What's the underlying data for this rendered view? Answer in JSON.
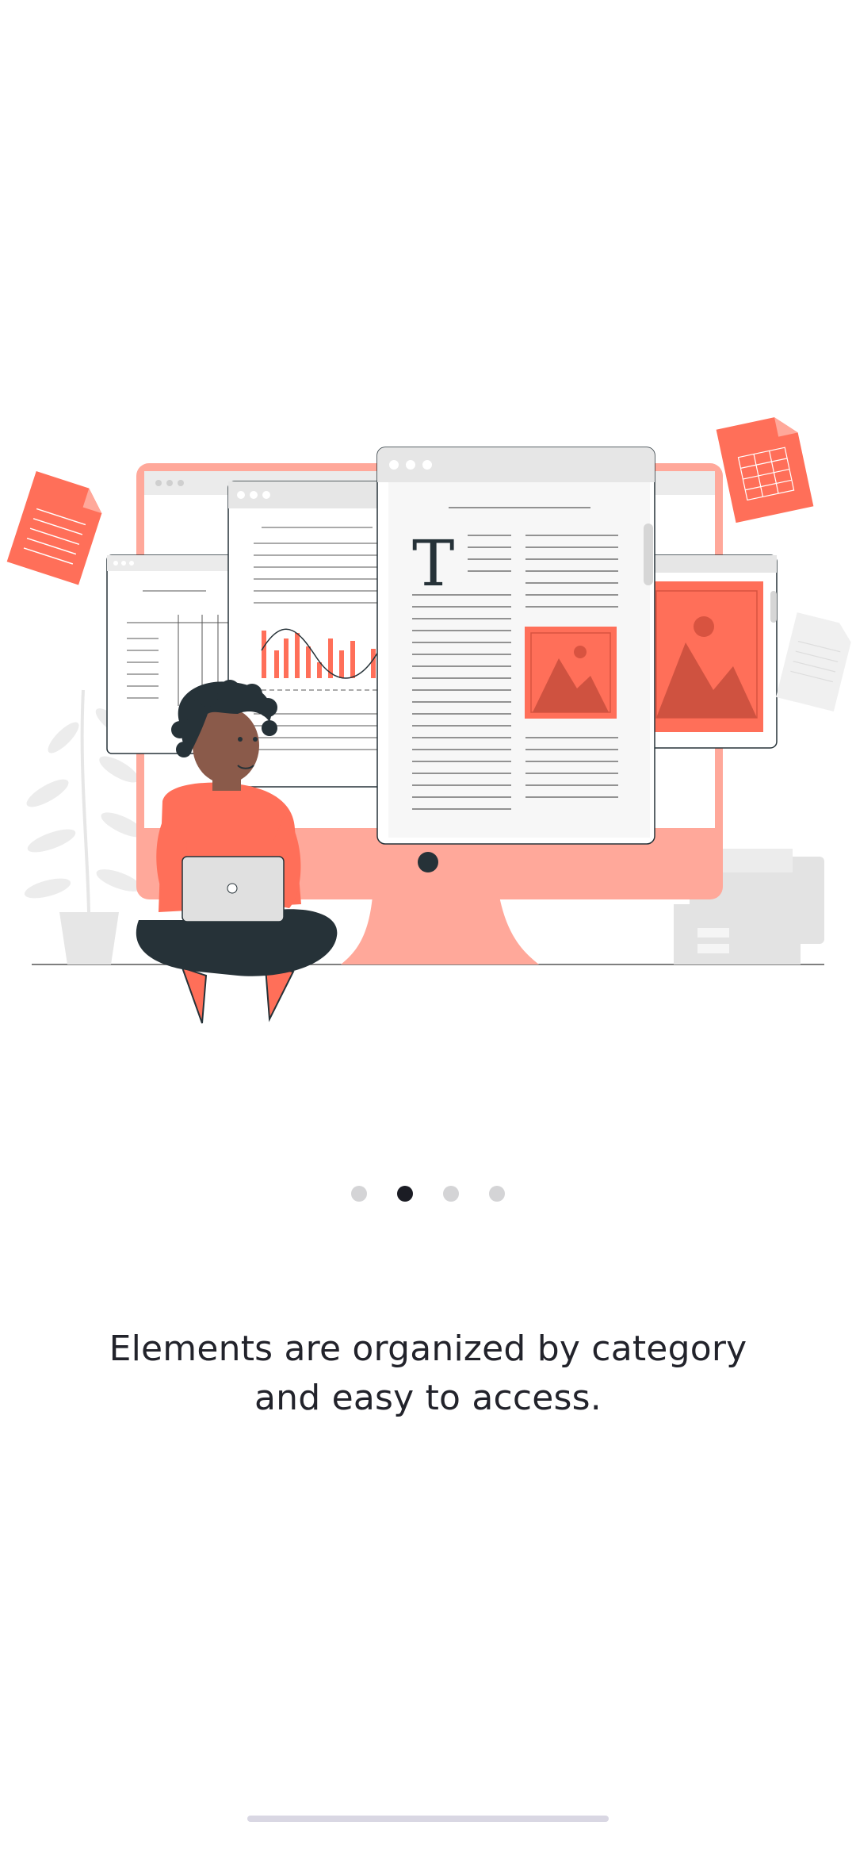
{
  "onboarding": {
    "caption": "Elements are organized by category\nand easy to access.",
    "illustration_icon": "person-with-laptop-and-documents-illustration",
    "pager": {
      "total": 4,
      "active_index": 1
    }
  },
  "colors": {
    "accent": "#ff6f59",
    "accent_light": "#ffa89a",
    "dark": "#263238",
    "gray": "#e6e6e6",
    "dot_active": "#1b1c24",
    "dot_inactive": "#d4d4d6",
    "text": "#22232b"
  }
}
